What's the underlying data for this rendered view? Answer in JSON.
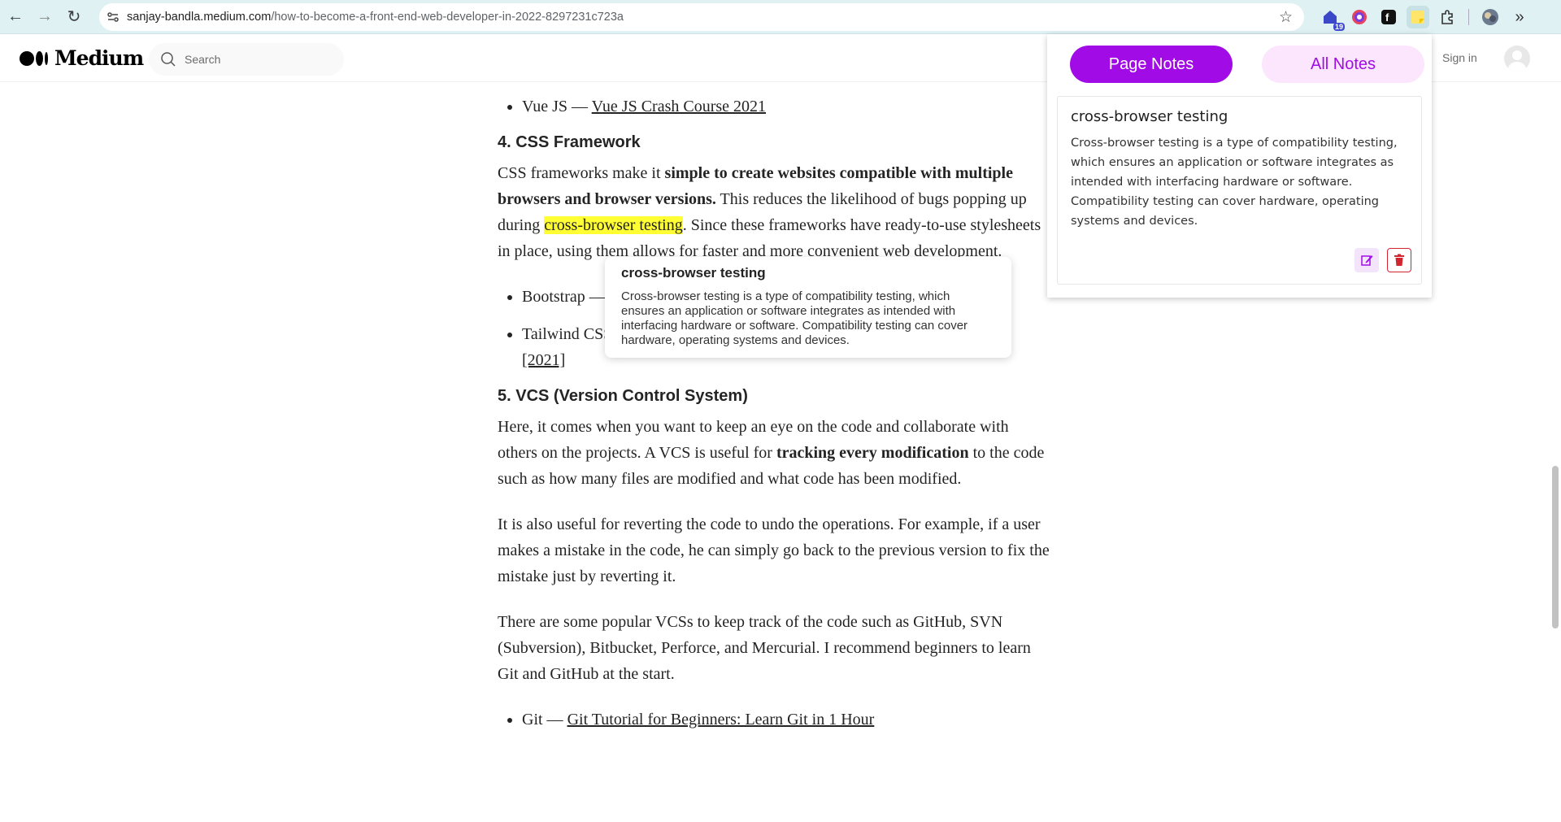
{
  "browser": {
    "url_host": "sanjay-bandla.medium.com",
    "url_path": "/how-to-become-a-front-end-web-developer-in-2022-8297231c723a",
    "extension_badge": "19"
  },
  "header": {
    "logo_text": "Medium",
    "search_placeholder": "Search",
    "signin": "Sign in"
  },
  "article": {
    "vue_label": "Vue JS — ",
    "vue_link": "Vue JS Crash Course 2021",
    "h_css": "4. CSS Framework",
    "p1_a": "CSS frameworks make it ",
    "p1_b": "simple to create websites compatible with multiple browsers and browser versions.",
    "p1_c": " This reduces the likelihood of bugs popping up during ",
    "p1_hl": "cross-browser testing",
    "p1_d": ". Since these frameworks have ready-to-use stylesheets in pl",
    "p1_e": "ace, using them allows for faster and more convenient web development.",
    "bootstrap_label": "Bootstrap — ",
    "tailwind_label": "Tailwind CSS — ",
    "tailwind_link": "Tailwind Complete Course For Beginner to Advanced — [2021]",
    "h_vcs": "5. VCS (Version Control System)",
    "p2_a": "Here, it comes when you want to keep an eye on the code and collaborate with others on the projects. A VCS is useful for ",
    "p2_b": "tracking every modification",
    "p2_c": " to the code such as how many files are modified and what code has been modified.",
    "p3": "It is also useful for reverting the code to undo the operations. For example, if a user makes a mistake in the code, he can simply go back to the previous version to fix the mistake just by reverting it.",
    "p4": "There are some popular VCSs to keep track of the code such as GitHub, SVN (Subversion), Bitbucket, Perforce, and Mercurial. I recommend beginners to learn Git and GitHub at the start.",
    "git_label": "Git — ",
    "git_link": "Git Tutorial for Beginners: Learn Git in 1 Hour"
  },
  "tooltip": {
    "title": "cross-browser testing",
    "body": "Cross-browser testing is a type of compatibility testing, which ensures an application or software integrates as intended with interfacing hardware or software. Compatibility testing can cover hardware, operating systems and devices."
  },
  "notes_popup": {
    "tab_page": "Page Notes",
    "tab_all": "All Notes",
    "note_title": "cross-browser testing",
    "note_body": "Cross-browser testing is a type of compatibility testing, which ensures an application or software integrates as intended with interfacing hardware or software. Compatibility testing can cover hardware, operating systems and devices."
  },
  "colors": {
    "accent": "#a10ce6",
    "highlight": "#ffff33",
    "delete": "#d2262f"
  }
}
